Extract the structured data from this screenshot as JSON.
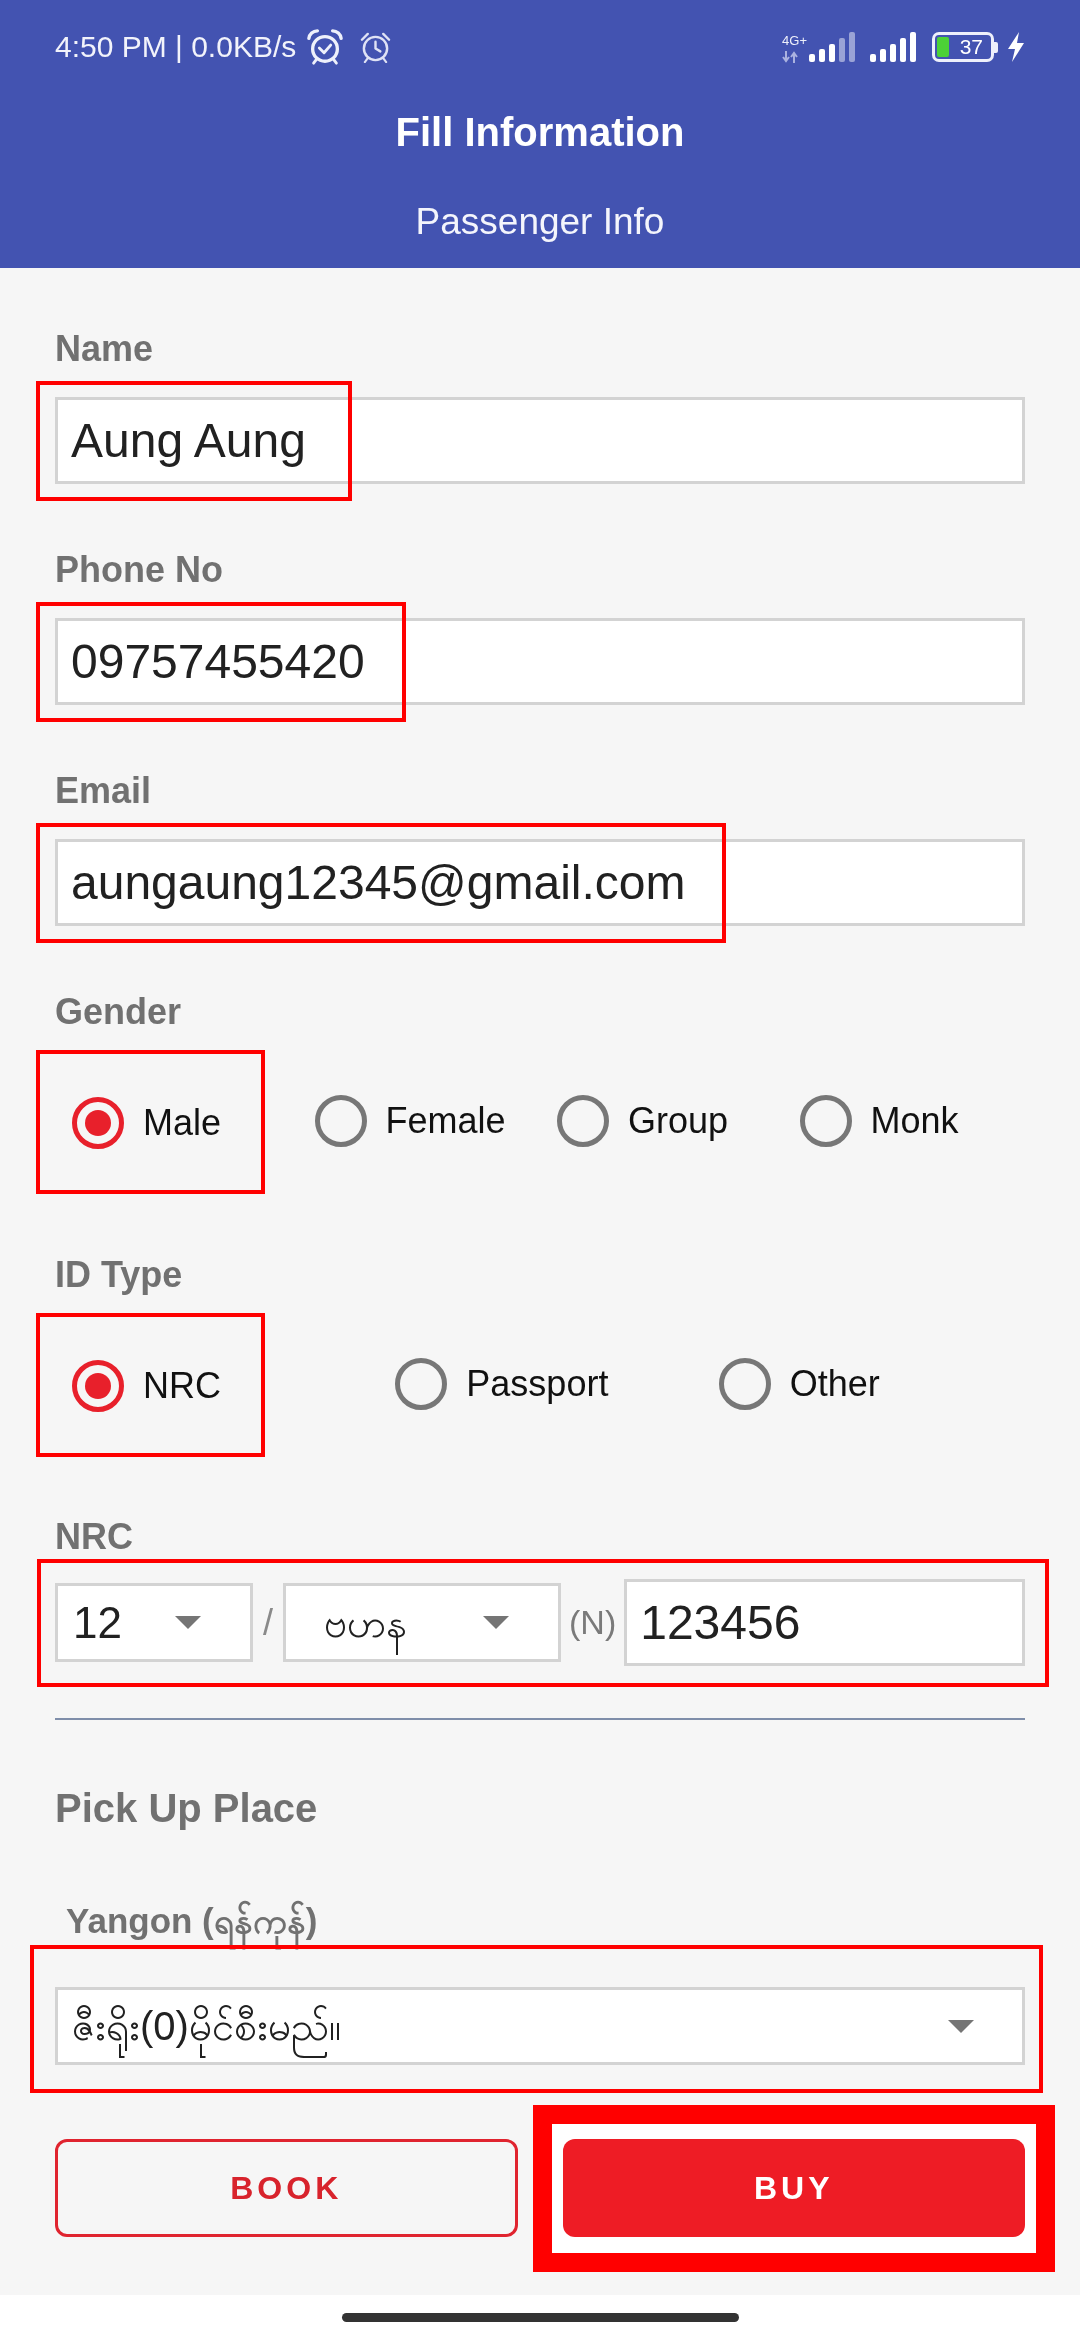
{
  "status_bar": {
    "time": "4:50 PM | 0.0KB/s",
    "network_type": "4G+",
    "battery": "37"
  },
  "header": {
    "title": "Fill Information",
    "subtitle": "Passenger Info"
  },
  "fields": [
    {
      "label": "Name",
      "value": "Aung Aung",
      "highlighted": true
    },
    {
      "label": "Phone No",
      "value": "09757455420",
      "highlighted": true
    },
    {
      "label": "Email",
      "value": "aungaung12345@gmail.com",
      "highlighted": true
    }
  ],
  "radio_groups": [
    {
      "label": "Gender",
      "options": [
        {
          "label": "Male",
          "selected": true,
          "highlighted": true
        },
        {
          "label": "Female",
          "selected": false,
          "highlighted": false
        },
        {
          "label": "Group",
          "selected": false,
          "highlighted": false
        },
        {
          "label": "Monk",
          "selected": false,
          "highlighted": false
        }
      ]
    },
    {
      "label": "ID Type",
      "options": [
        {
          "label": "NRC",
          "selected": true,
          "highlighted": true
        },
        {
          "label": "Passport",
          "selected": false,
          "highlighted": false
        },
        {
          "label": "Other",
          "selected": false,
          "highlighted": false
        }
      ]
    }
  ],
  "nrc": {
    "label": "NRC",
    "highlighted": true,
    "state_code": "12",
    "separator": "/",
    "township": "ဗဟန",
    "citizen_type": "(N)",
    "number": "123456"
  },
  "pickup": {
    "heading": "Pick Up Place",
    "city": "Yangon (ရန်ကုန်)",
    "place": "ဇီးရိုး(0)မိုင်စီးမည်။",
    "highlighted": true
  },
  "buttons": [
    {
      "label": "BOOK",
      "kind": "outline",
      "highlighted": false
    },
    {
      "label": "BUY",
      "kind": "filled",
      "highlighted": true
    }
  ]
}
